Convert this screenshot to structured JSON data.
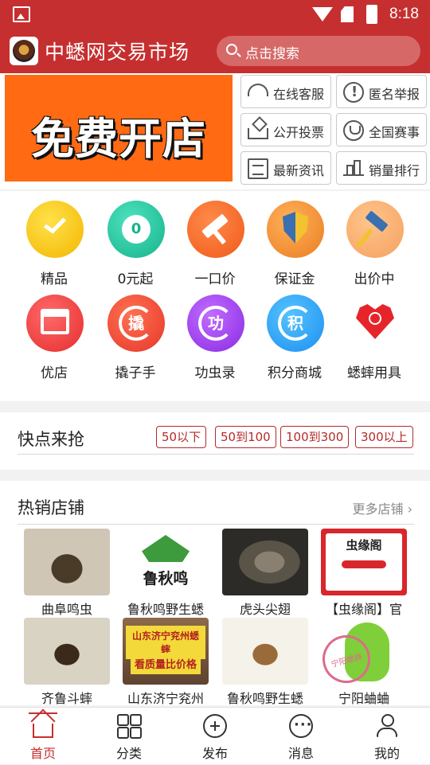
{
  "status_bar": {
    "time": "8:18"
  },
  "header": {
    "title": "中蟋网交易市场",
    "search_placeholder": "点击搜索"
  },
  "banner": {
    "text": "免费开店"
  },
  "quick_links": [
    {
      "label": "在线客服",
      "icon": "headset-icon"
    },
    {
      "label": "匿名举报",
      "icon": "exclamation-icon"
    },
    {
      "label": "公开投票",
      "icon": "vote-icon"
    },
    {
      "label": "全国赛事",
      "icon": "trophy-icon"
    },
    {
      "label": "最新资讯",
      "icon": "news-icon"
    },
    {
      "label": "销量排行",
      "icon": "bar-chart-icon"
    }
  ],
  "categories": [
    {
      "label": "精品",
      "icon": "diamond-icon",
      "color": "#f3b600"
    },
    {
      "label": "0元起",
      "icon": "zero-badge-icon",
      "badge": "0",
      "color": "#14b38a"
    },
    {
      "label": "一口价",
      "icon": "gavel-icon",
      "color": "#f05a1a"
    },
    {
      "label": "保证金",
      "icon": "shield-icon",
      "color": "#ea7d22"
    },
    {
      "label": "出价中",
      "icon": "auction-hammer-icon",
      "color": "#f5a060"
    },
    {
      "label": "优店",
      "icon": "store-icon",
      "color": "#e52d2d"
    },
    {
      "label": "撬子手",
      "icon": "qiao-badge-icon",
      "badge": "撬",
      "color": "#e5382b"
    },
    {
      "label": "功虫录",
      "icon": "gong-badge-icon",
      "badge": "功",
      "color": "#8a2be2"
    },
    {
      "label": "积分商城",
      "icon": "points-badge-icon",
      "badge": "积",
      "color": "#1e8ff0"
    },
    {
      "label": "蟋蟀用具",
      "icon": "heart-pin-icon",
      "color": "#e6252b"
    }
  ],
  "quick_grab": {
    "title": "快点来抢",
    "price_filters": [
      "50以下",
      "50到100",
      "100到300",
      "300以上"
    ]
  },
  "hot_shops": {
    "title": "热销店铺",
    "more_label": "更多店铺",
    "shops": [
      {
        "name": "曲阜鸣虫"
      },
      {
        "name": "鲁秋鸣野生蟋",
        "logo_text": "鲁秋鸣"
      },
      {
        "name": "虎头尖翅"
      },
      {
        "name": "【虫缘阁】官",
        "logo_text": "虫缘阁"
      },
      {
        "name": "齐鲁斗蟀"
      },
      {
        "name": "山东济宁兖州",
        "banner_top": "山东济宁兖州蟋蟀",
        "banner_bottom": "看质量比价格"
      },
      {
        "name": "鲁秋鸣野生蟋"
      },
      {
        "name": "宁阳蛐蛐",
        "stamp_text": "宁阳蟋蟀"
      }
    ]
  },
  "bottom_nav": [
    {
      "label": "首页",
      "icon": "home-icon",
      "active": true
    },
    {
      "label": "分类",
      "icon": "grid-icon",
      "active": false
    },
    {
      "label": "发布",
      "icon": "plus-circle-icon",
      "active": false
    },
    {
      "label": "消息",
      "icon": "message-icon",
      "active": false
    },
    {
      "label": "我的",
      "icon": "user-icon",
      "active": false
    }
  ],
  "colors": {
    "brand": "#c62f2f",
    "banner": "#ff6a13"
  }
}
